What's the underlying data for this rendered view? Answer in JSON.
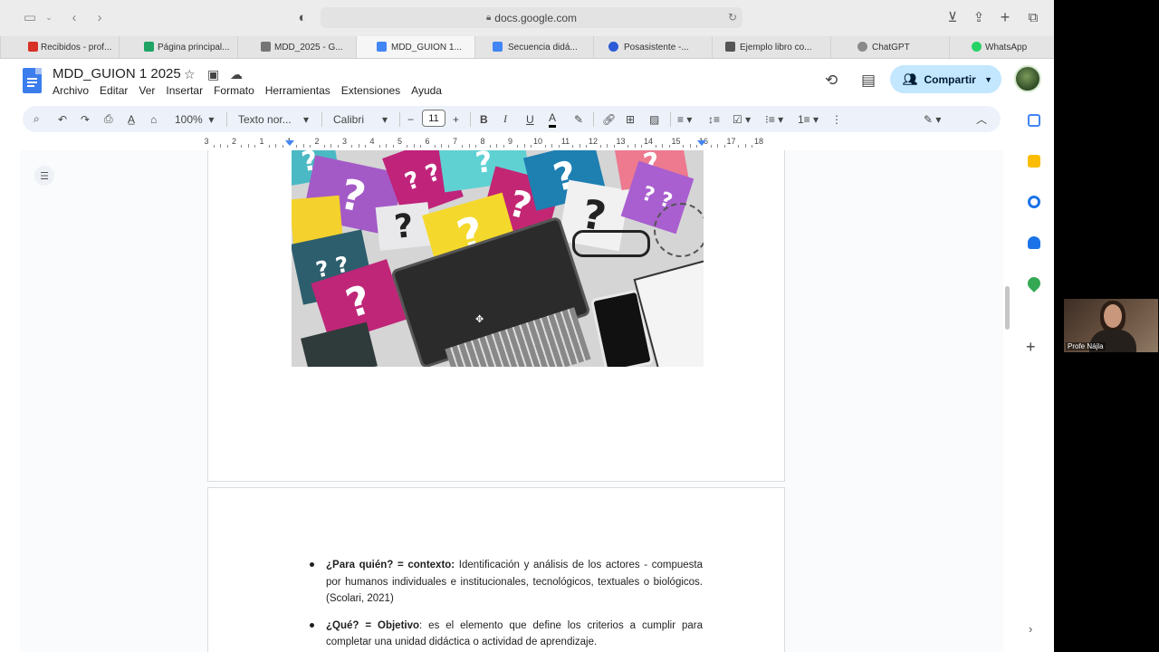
{
  "browser": {
    "url": "docs.google.com",
    "tabs": [
      {
        "label": "Recibidos - prof...",
        "icon": "gmail-icon",
        "color": "#d93025"
      },
      {
        "label": "Página principal...",
        "icon": "drive-icon",
        "color": "#1fa463"
      },
      {
        "label": "MDD_2025 - G...",
        "icon": "forms-icon",
        "color": "#757575"
      },
      {
        "label": "MDD_GUION 1...",
        "icon": "docs-icon",
        "color": "#4285f4"
      },
      {
        "label": "Secuencia didá...",
        "icon": "docs-icon",
        "color": "#4285f4"
      },
      {
        "label": "Posasistente -...",
        "icon": "zoom-icon",
        "color": "#2d5bd8"
      },
      {
        "label": "Ejemplo libro co...",
        "icon": "pdf-icon",
        "color": "#555555"
      },
      {
        "label": "ChatGPT",
        "icon": "chatgpt-icon",
        "color": "#8a8a8a"
      },
      {
        "label": "WhatsApp",
        "icon": "whatsapp-icon",
        "color": "#25d366"
      }
    ]
  },
  "doc": {
    "title": "MDD_GUION 1 2025",
    "menus": [
      "Archivo",
      "Editar",
      "Ver",
      "Insertar",
      "Formato",
      "Herramientas",
      "Extensiones",
      "Ayuda"
    ],
    "share_label": "Compartir"
  },
  "toolbar": {
    "zoom": "100%",
    "style": "Texto nor...",
    "font": "Calibri",
    "font_size": "11"
  },
  "ruler": {
    "labels": [
      "3",
      "2",
      "1",
      "1",
      "2",
      "3",
      "4",
      "5",
      "6",
      "7",
      "8",
      "9",
      "10",
      "11",
      "12",
      "13",
      "14",
      "15",
      "16",
      "17",
      "18"
    ]
  },
  "content": {
    "bullets": [
      {
        "bold": "¿Para quién? = contexto:",
        "text": " Identificación y análisis de los actores - compuesta por humanos individuales e institucionales, tecnológicos, textuales o biológicos. (Scolari, 2021)"
      },
      {
        "bold": "¿Qué? = Objetivo",
        "text": ": es el elemento que define los criterios a cumplir para completar una unidad didáctica o actividad de aprendizaje."
      }
    ]
  },
  "webcam": {
    "name": "Profe Nájla"
  },
  "colors": {
    "accent": "#c2e7ff",
    "toolbar_bg": "#edf2fa",
    "docs_blue": "#4285f4"
  }
}
